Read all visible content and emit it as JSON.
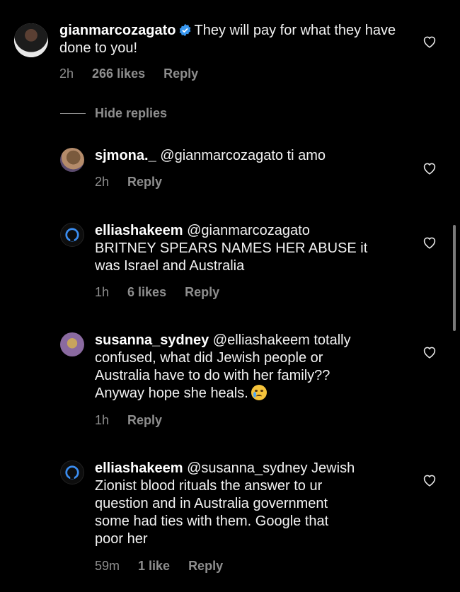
{
  "comments": [
    {
      "username": "gianmarcozagato",
      "verified": true,
      "text": "They will pay for what they have done to you!",
      "time": "2h",
      "likes": "266 likes",
      "reply": "Reply"
    }
  ],
  "hide_replies_label": "Hide replies",
  "replies": [
    {
      "username": "sjmona._",
      "text": "@gianmarcozagato ti amo",
      "time": "2h",
      "likes": "",
      "reply": "Reply"
    },
    {
      "username": "elliashakeem",
      "text_lines": [
        "@gianmarcozagato",
        "BRITNEY SPEARS NAMES HER ABUSE it",
        "was Israel and Australia"
      ],
      "time": "1h",
      "likes": "6 likes",
      "reply": "Reply"
    },
    {
      "username": "susanna_sydney",
      "text_lines": [
        "@elliashakeem totally",
        "confused, what did Jewish people or",
        "Australia have to do with her family??",
        "Anyway hope she heals."
      ],
      "emoji": "crying-face",
      "time": "1h",
      "likes": "",
      "reply": "Reply"
    },
    {
      "username": "elliashakeem",
      "text_lines": [
        "@susanna_sydney Jewish",
        "Zionist blood rituals the answer to ur",
        "question and in Australia government",
        "some had ties with them. Google that",
        "poor her"
      ],
      "time": "59m",
      "likes": "1 like",
      "reply": "Reply"
    }
  ],
  "colors": {
    "background": "#000000",
    "text": "#f2f2f2",
    "muted": "#8e8e8e",
    "verified": "#3897f0"
  }
}
